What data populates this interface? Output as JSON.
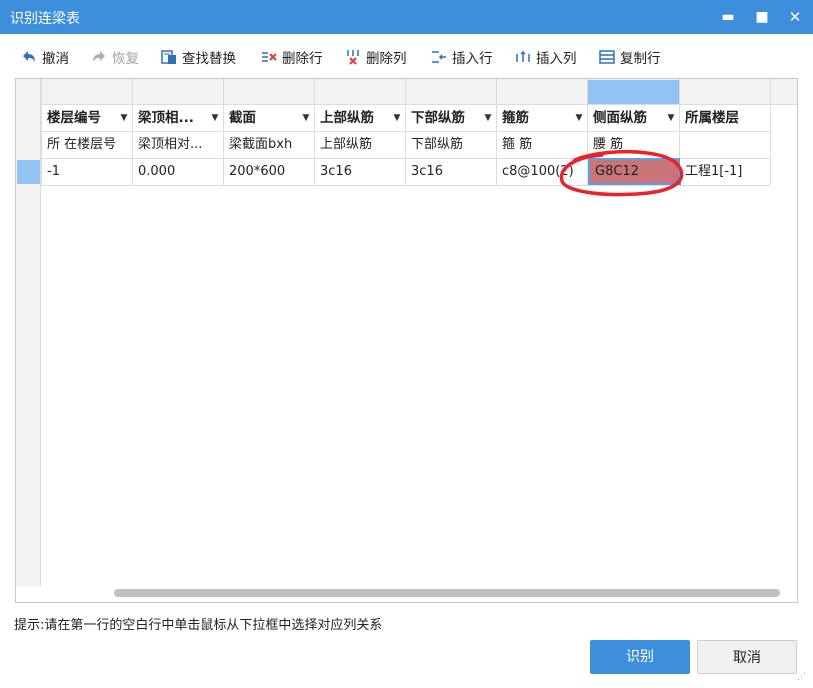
{
  "window": {
    "title": "识别连梁表",
    "minimize_glyph": "▬",
    "maximize_glyph": "■",
    "close_glyph": "✕"
  },
  "toolbar": {
    "undo": "撤消",
    "redo": "恢复",
    "find_replace": "查找替换",
    "delete_row": "删除行",
    "delete_col": "删除列",
    "insert_row": "插入行",
    "insert_col": "插入列",
    "copy_row": "复制行"
  },
  "table": {
    "headers": [
      "楼层编号",
      "梁顶相...",
      "截面",
      "上部纵筋",
      "下部纵筋",
      "箍筋",
      "侧面纵筋",
      "所属楼层"
    ],
    "header_has_dropdown": [
      true,
      true,
      true,
      true,
      true,
      true,
      true,
      false
    ],
    "rows": [
      [
        "所 在楼层号",
        "梁顶相对...",
        "梁截面bxh",
        "上部纵筋",
        "下部纵筋",
        "箍   筋",
        "腰   筋",
        ""
      ],
      [
        "-1",
        "0.000",
        "200*600",
        "3c16",
        "3c16",
        "c8@100(2)",
        "G8C12",
        "工程1[-1]"
      ]
    ],
    "selected_cell": {
      "row": 2,
      "col": 7
    }
  },
  "status": {
    "hint": "提示:请在第一行的空白行中单击鼠标从下拉框中选择对应列关系"
  },
  "buttons": {
    "ok": "识别",
    "cancel": "取消"
  },
  "colors": {
    "accent": "#3d8fdc",
    "selection": "#91c4f5",
    "highlight_cell": "#c87478",
    "annotation": "#e8232a"
  }
}
